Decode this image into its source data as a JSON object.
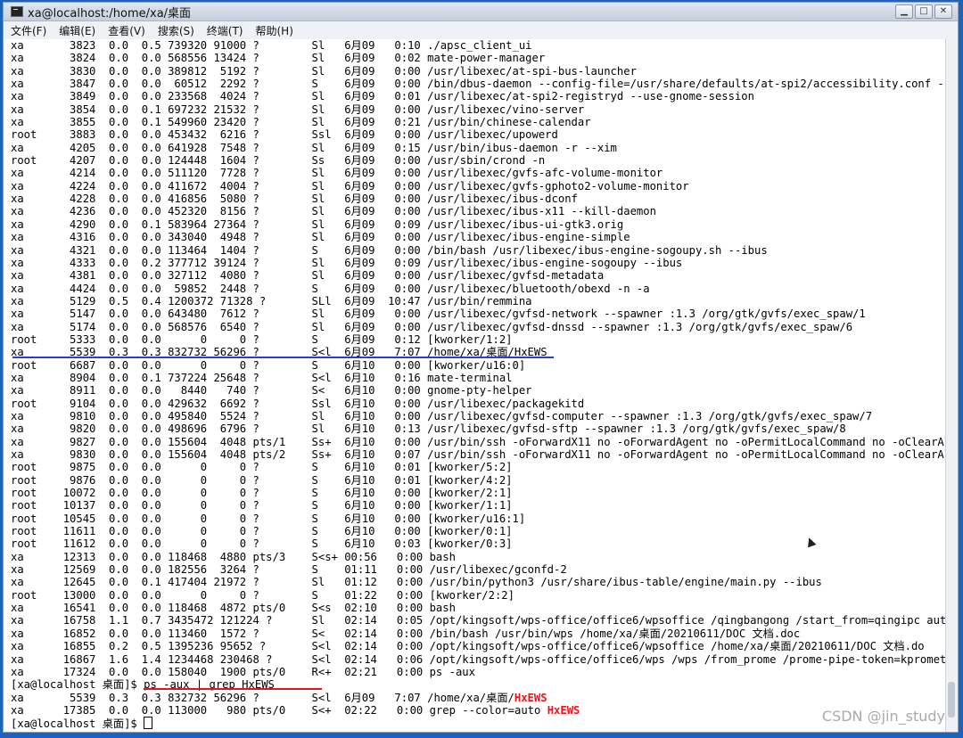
{
  "window": {
    "title": "xa@localhost:/home/xa/桌面",
    "controls": {
      "minimize": "▁",
      "maximize": "□",
      "close": "✕"
    }
  },
  "menu": [
    "文件(F)",
    "编辑(E)",
    "查看(V)",
    "搜索(S)",
    "终端(T)",
    "帮助(H)"
  ],
  "terminal": {
    "lines": [
      "xa       3823  0.0  0.5 739320 91000 ?        Sl   6月09   0:10 ./apsc_client_ui",
      "xa       3824  0.0  0.0 568556 13424 ?        Sl   6月09   0:02 mate-power-manager",
      "xa       3830  0.0  0.0 389812  5192 ?        Sl   6月09   0:00 /usr/libexec/at-spi-bus-launcher",
      "xa       3847  0.0  0.0  60512  2292 ?        S    6月09   0:00 /bin/dbus-daemon --config-file=/usr/share/defaults/at-spi2/accessibility.conf --nofork --print-",
      "xa       3849  0.0  0.0 233568  4024 ?        Sl   6月09   0:01 /usr/libexec/at-spi2-registryd --use-gnome-session",
      "xa       3854  0.0  0.1 697232 21532 ?        Sl   6月09   0:00 /usr/libexec/vino-server",
      "xa       3855  0.0  0.1 549960 23420 ?        Sl   6月09   0:21 /usr/bin/chinese-calendar",
      "root     3883  0.0  0.0 453432  6216 ?        Ssl  6月09   0:00 /usr/libexec/upowerd",
      "xa       4205  0.0  0.0 641928  7548 ?        Sl   6月09   0:15 /usr/bin/ibus-daemon -r --xim",
      "root     4207  0.0  0.0 124448  1604 ?        Ss   6月09   0:00 /usr/sbin/crond -n",
      "xa       4214  0.0  0.0 511120  7728 ?        Sl   6月09   0:00 /usr/libexec/gvfs-afc-volume-monitor",
      "xa       4224  0.0  0.0 411672  4004 ?        Sl   6月09   0:00 /usr/libexec/gvfs-gphoto2-volume-monitor",
      "xa       4228  0.0  0.0 416856  5080 ?        Sl   6月09   0:00 /usr/libexec/ibus-dconf",
      "xa       4236  0.0  0.0 452320  8156 ?        Sl   6月09   0:00 /usr/libexec/ibus-x11 --kill-daemon",
      "xa       4290  0.0  0.1 583964 27364 ?        Sl   6月09   0:09 /usr/libexec/ibus-ui-gtk3.orig",
      "xa       4316  0.0  0.0 343040  4948 ?        Sl   6月09   0:00 /usr/libexec/ibus-engine-simple",
      "xa       4321  0.0  0.0 113464  1404 ?        S    6月09   0:00 /bin/bash /usr/libexec/ibus-engine-sogoupy.sh --ibus",
      "xa       4333  0.0  0.2 377712 39124 ?        Sl   6月09   0:09 /usr/libexec/ibus-engine-sogoupy --ibus",
      "xa       4381  0.0  0.0 327112  4080 ?        Sl   6月09   0:00 /usr/libexec/gvfsd-metadata",
      "xa       4424  0.0  0.0  59852  2448 ?        S    6月09   0:00 /usr/libexec/bluetooth/obexd -n -a",
      "xa       5129  0.5  0.4 1200372 71328 ?       SLl  6月09  10:47 /usr/bin/remmina",
      "xa       5147  0.0  0.0 643480  7612 ?        Sl   6月09   0:00 /usr/libexec/gvfsd-network --spawner :1.3 /org/gtk/gvfs/exec_spaw/1",
      "xa       5174  0.0  0.0 568576  6540 ?        Sl   6月09   0:00 /usr/libexec/gvfsd-dnssd --spawner :1.3 /org/gtk/gvfs/exec_spaw/6",
      "root     5333  0.0  0.0      0     0 ?        S    6月09   0:12 [kworker/1:2]",
      "xa       5539  0.3  0.3 832732 56296 ?        S<l  6月09   7:07 /home/xa/桌面/HxEWS",
      "root     6687  0.0  0.0      0     0 ?        S    6月10   0:00 [kworker/u16:0]",
      "xa       8904  0.0  0.1 737224 25648 ?        S<l  6月10   0:16 mate-terminal",
      "xa       8911  0.0  0.0   8440   740 ?        S<   6月10   0:00 gnome-pty-helper",
      "root     9104  0.0  0.0 429632  6692 ?        Ssl  6月10   0:00 /usr/libexec/packagekitd",
      "xa       9810  0.0  0.0 495840  5524 ?        Sl   6月10   0:00 /usr/libexec/gvfsd-computer --spawner :1.3 /org/gtk/gvfs/exec_spaw/7",
      "xa       9820  0.0  0.0 498696  6796 ?        Sl   6月10   0:13 /usr/libexec/gvfsd-sftp --spawner :1.3 /org/gtk/gvfs/exec_spaw/8",
      "xa       9827  0.0  0.0 155604  4048 pts/1    Ss+  6月10   0:00 /usr/bin/ssh -oForwardX11 no -oForwardAgent no -oPermitLocalCommand no -oClearAl",
      "xa       9830  0.0  0.0 155604  4048 pts/2    Ss+  6月10   0:07 /usr/bin/ssh -oForwardX11 no -oForwardAgent no -oPermitLocalCommand no -oClearAl",
      "root     9875  0.0  0.0      0     0 ?        S    6月10   0:01 [kworker/5:2]",
      "root     9876  0.0  0.0      0     0 ?        S    6月10   0:01 [kworker/4:2]",
      "root    10072  0.0  0.0      0     0 ?        S    6月10   0:00 [kworker/2:1]",
      "root    10137  0.0  0.0      0     0 ?        S    6月10   0:00 [kworker/1:1]",
      "root    10545  0.0  0.0      0     0 ?        S    6月10   0:00 [kworker/u16:1]",
      "root    11611  0.0  0.0      0     0 ?        S    6月10   0:00 [kworker/0:1]",
      "root    11612  0.0  0.0      0     0 ?        S    6月10   0:03 [kworker/0:3]",
      "xa      12313  0.0  0.0 118468  4880 pts/3    S<s+ 00:56   0:00 bash",
      "xa      12569  0.0  0.0 182556  3264 ?        S    01:11   0:00 /usr/libexec/gconfd-2",
      "xa      12645  0.0  0.1 417404 21972 ?        Sl   01:12   0:00 /usr/bin/python3 /usr/share/ibus-table/engine/main.py --ibus",
      "root    13000  0.0  0.0      0     0 ?        S    01:22   0:00 [kworker/2:2]",
      "xa      16541  0.0  0.0 118468  4872 pts/0    S<s  02:10   0:00 bash",
      "xa      16758  1.1  0.7 3435472 121224 ?      Sl   02:14   0:05 /opt/kingsoft/wps-office/office6/wpsoffice /qingbangong /start_from=qingipc autol",
      "xa      16852  0.0  0.0 113460  1572 ?        S<   02:14   0:00 /bin/bash /usr/bin/wps /home/xa/桌面/20210611/DOC 文档.doc",
      "xa      16855  0.2  0.5 1395236 95652 ?       S<l  02:14   0:00 /opt/kingsoft/wps-office/office6/wpsoffice /home/xa/桌面/20210611/DOC 文档.do",
      "xa      16867  1.6  1.4 1234468 230468 ?      S<l  02:14   0:06 /opt/kingsoft/wps-office/office6/wps /wps /from_prome /prome-pipe-token=kpromethe",
      "xa      17324  0.0  0.0 158040  1900 pts/0    R<+  02:21   0:00 ps -aux"
    ],
    "prompt": "[xa@localhost 桌面]$ ",
    "grep_command": "ps -aux | grep HxEWS",
    "grep_results": [
      {
        "before": "xa       5539  0.3  0.3 832732 56296 ?        S<l  6月09   7:07 /home/xa/桌面/",
        "match": "HxEWS",
        "after": ""
      },
      {
        "before": "xa      17385  0.0  0.0 113000   980 pts/0    S<+  02:22   0:00 grep --color=auto ",
        "match": "HxEWS",
        "after": ""
      }
    ]
  },
  "watermark": "CSDN @jin_study",
  "colors": {
    "highlight": "#e8141b",
    "underline_blue": "#2840c9",
    "desktop": "#1d63b8"
  }
}
